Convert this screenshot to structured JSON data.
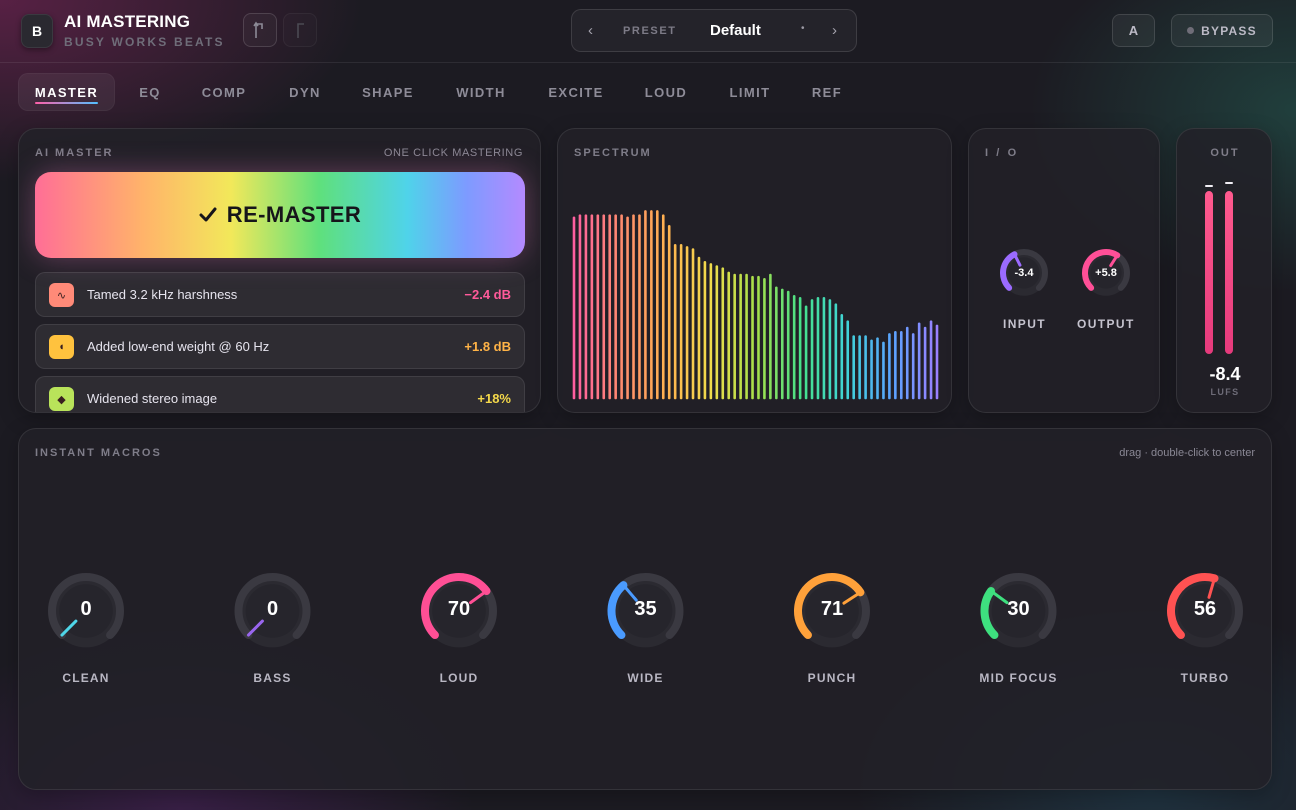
{
  "header": {
    "logo_letter": "B",
    "title": "AI MASTERING",
    "subtitle": "BUSY WORKS BEATS",
    "undo_icon": "undo-icon",
    "redo_icon": "redo-icon",
    "preset": {
      "label": "PRESET",
      "value": "Default",
      "prev": "‹",
      "next": "›",
      "dropdown": "•"
    },
    "ab_label": "A",
    "bypass_label": "BYPASS"
  },
  "tabs": [
    {
      "label": "MASTER",
      "active": true
    },
    {
      "label": "EQ"
    },
    {
      "label": "COMP"
    },
    {
      "label": "DYN"
    },
    {
      "label": "SHAPE"
    },
    {
      "label": "WIDTH"
    },
    {
      "label": "EXCITE"
    },
    {
      "label": "LOUD"
    },
    {
      "label": "LIMIT"
    },
    {
      "label": "REF"
    }
  ],
  "ai_master": {
    "title": "AI MASTER",
    "subtitle": "ONE CLICK MASTERING",
    "button_label": "RE-MASTER",
    "log": [
      {
        "text": "Tamed 3.2 kHz harshness",
        "value": "−2.4 dB",
        "color": "#ff5a9a",
        "icon_bg": "#ff8a78",
        "icon": "∿"
      },
      {
        "text": "Added low-end weight @ 60 Hz",
        "value": "+1.8 dB",
        "color": "#ffb347",
        "icon_bg": "#ffc23e",
        "icon": "◖"
      },
      {
        "text": "Widened stereo image",
        "value": "+18%",
        "color": "#f4d84a",
        "icon_bg": "#b9e35a",
        "icon": "◆"
      }
    ]
  },
  "spectrum": {
    "title": "SPECTRUM",
    "levels": [
      0.85,
      0.86,
      0.86,
      0.86,
      0.86,
      0.86,
      0.86,
      0.86,
      0.86,
      0.85,
      0.86,
      0.86,
      0.88,
      0.88,
      0.88,
      0.86,
      0.81,
      0.72,
      0.72,
      0.71,
      0.7,
      0.66,
      0.64,
      0.63,
      0.62,
      0.61,
      0.59,
      0.58,
      0.58,
      0.58,
      0.57,
      0.57,
      0.56,
      0.58,
      0.52,
      0.51,
      0.5,
      0.48,
      0.47,
      0.43,
      0.46,
      0.47,
      0.47,
      0.46,
      0.44,
      0.39,
      0.36,
      0.29,
      0.29,
      0.29,
      0.27,
      0.28,
      0.26,
      0.3,
      0.31,
      0.31,
      0.33,
      0.3,
      0.35,
      0.33,
      0.36,
      0.34
    ]
  },
  "io": {
    "title": "I / O",
    "input": {
      "label": "INPUT",
      "value": "-3.4",
      "fraction": 0.4,
      "color": "#9b6bff"
    },
    "output": {
      "label": "OUTPUT",
      "value": "+5.8",
      "fraction": 0.62,
      "color": "#ff4f97"
    }
  },
  "out_meter": {
    "title": "OUT",
    "left_level": 0.97,
    "right_level": 0.97,
    "lufs_value": "-8.4",
    "lufs_label": "LUFS"
  },
  "macros": {
    "title": "INSTANT MACROS",
    "hint": "drag · double-click to center",
    "knobs": [
      {
        "label": "CLEAN",
        "value": "0",
        "fraction": 0.0,
        "color": "#4fd6e8"
      },
      {
        "label": "BASS",
        "value": "0",
        "fraction": 0.0,
        "color": "#9966ee"
      },
      {
        "label": "LOUD",
        "value": "70",
        "fraction": 0.7,
        "color": "#ff4f95"
      },
      {
        "label": "WIDE",
        "value": "35",
        "fraction": 0.35,
        "color": "#4a9bff"
      },
      {
        "label": "PUNCH",
        "value": "71",
        "fraction": 0.71,
        "color": "#ffa13a"
      },
      {
        "label": "MID FOCUS",
        "value": "30",
        "fraction": 0.3,
        "color": "#3ee07f"
      },
      {
        "label": "TURBO",
        "value": "56",
        "fraction": 0.56,
        "color": "#ff5252"
      }
    ]
  }
}
